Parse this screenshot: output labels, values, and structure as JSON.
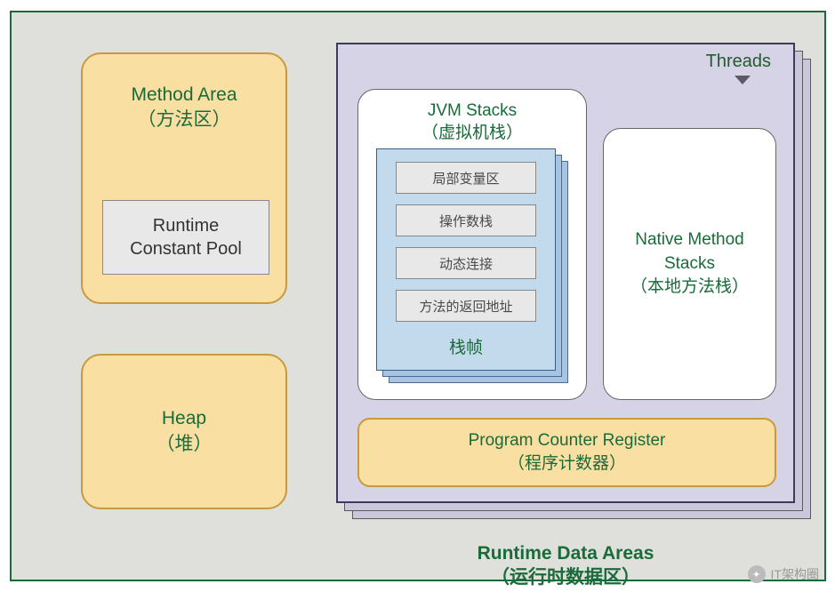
{
  "diagram": {
    "title_en": "Runtime Data Areas",
    "title_cn": "（运行时数据区）",
    "method_area": {
      "title_en": "Method Area",
      "title_cn": "（方法区）",
      "rcp": "Runtime\nConstant Pool"
    },
    "heap": {
      "title_en": "Heap",
      "title_cn": "（堆）"
    },
    "threads": {
      "label": "Threads",
      "jvm_stacks": {
        "title_en": "JVM Stacks",
        "title_cn": "（虚拟机栈）",
        "frame_label": "栈帧",
        "items": [
          "局部变量区",
          "操作数栈",
          "动态连接",
          "方法的返回地址"
        ]
      },
      "native_stacks": {
        "title_en": "Native Method\nStacks",
        "title_cn": "（本地方法栈）"
      },
      "pc_register": {
        "title_en": "Program Counter Register",
        "title_cn": "（程序计数器）"
      }
    },
    "watermark": "IT架构圈"
  }
}
